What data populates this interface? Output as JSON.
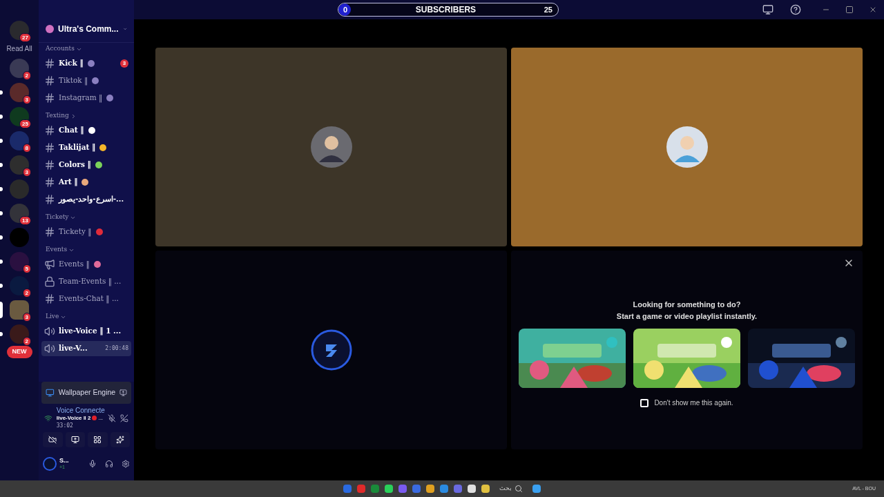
{
  "top_bar": {
    "counter": {
      "label": "SUBSCRIBERS",
      "start": "0",
      "end": "25",
      "level": 0.04
    }
  },
  "servers": {
    "read_all": "Read All",
    "items": [
      {
        "badge": "27",
        "color": "#2a2a2e",
        "unread": false,
        "selected": false
      },
      {
        "badge": "2",
        "color": "#3a3a55",
        "unread": false,
        "selected": false
      },
      {
        "badge": "3",
        "color": "#5a2a2a",
        "unread": true,
        "selected": false
      },
      {
        "badge": "25",
        "color": "#0f3a1f",
        "unread": true,
        "selected": false
      },
      {
        "badge": "8",
        "color": "#1a2a6a",
        "unread": true,
        "selected": false
      },
      {
        "badge": "3",
        "color": "#2e2e2e",
        "unread": true,
        "selected": false
      },
      {
        "color": "#2a2a2a",
        "unread": true,
        "selected": false
      },
      {
        "badge": "13",
        "color": "#33333a",
        "unread": true,
        "selected": false
      },
      {
        "color": "#000000",
        "unread": true,
        "selected": false
      },
      {
        "badge": "5",
        "color": "#2a1040",
        "unread": true,
        "selected": false
      },
      {
        "badge": "2",
        "color": "#0a1a40",
        "unread": true,
        "selected": false
      },
      {
        "badge": "3",
        "color": "#6a5a40",
        "unread": false,
        "selected": true
      },
      {
        "badge": "2",
        "color": "#3a1a1a",
        "unread": true,
        "selected": false
      }
    ],
    "new_badge": "NEW"
  },
  "server_header": {
    "name": "Ultra's Comm..."
  },
  "categories": [
    {
      "name": "Accounts",
      "expanded": true,
      "channels": [
        {
          "kind": "text",
          "name": "Kick ‖",
          "emoji": {
            "kind": "people"
          },
          "badge": "3",
          "unread": true,
          "selected": false
        },
        {
          "kind": "text",
          "name": "Tiktok ‖",
          "emoji": {
            "kind": "people"
          },
          "unread": false,
          "selected": false
        },
        {
          "kind": "text",
          "name": "Instagram ‖",
          "emoji": {
            "kind": "people"
          },
          "unread": false,
          "selected": false
        }
      ]
    },
    {
      "name": "Texting",
      "expanded": false,
      "channels": [
        {
          "kind": "text",
          "name": "Chat ‖",
          "emoji": {
            "kind": "speech"
          },
          "unread": true,
          "selected": false
        },
        {
          "kind": "text",
          "name": "Taklijat ‖",
          "emoji": {
            "kind": "laugh"
          },
          "unread": true,
          "selected": false
        },
        {
          "kind": "text",
          "name": "Colors ‖",
          "emoji": {
            "kind": "pencil"
          },
          "unread": true,
          "selected": false
        },
        {
          "kind": "text",
          "name": "Art ‖",
          "emoji": {
            "kind": "palette"
          },
          "unread": true,
          "selected": false
        },
        {
          "kind": "text",
          "name": "اسرع-واحد-يصور-...",
          "unread": true,
          "selected": false
        }
      ]
    },
    {
      "name": "Tickety",
      "expanded": true,
      "channels": [
        {
          "kind": "text",
          "name": "Tickety ‖",
          "emoji": {
            "kind": "ticket"
          },
          "unread": false,
          "selected": false
        }
      ]
    },
    {
      "name": "Events",
      "expanded": true,
      "channels": [
        {
          "kind": "announce",
          "name": "Events ‖",
          "emoji": {
            "kind": "tent"
          },
          "unread": false,
          "selected": false
        },
        {
          "kind": "locked",
          "name": "Team-Events ‖ ...",
          "unread": false,
          "selected": false
        },
        {
          "kind": "text",
          "name": "Events-Chat ‖ ...",
          "unread": false,
          "selected": false
        }
      ]
    },
    {
      "name": "Live",
      "expanded": true,
      "channels": [
        {
          "kind": "voice",
          "name": "live-Voice ‖ 1 ...",
          "unread": true,
          "selected": false
        },
        {
          "kind": "voice",
          "name": "live-V...",
          "time": "2:00:48",
          "unread": true,
          "selected": true
        }
      ]
    }
  ],
  "activity": {
    "name": "Wallpaper Engine"
  },
  "voice_panel": {
    "status": "Voice Connecte",
    "channel": "live-Voice ‖ 2",
    "suffix": "...",
    "elapsed": "33:02"
  },
  "user_panel": {
    "name": "S...",
    "extra": "+1"
  },
  "tiles": [
    {
      "kind": "avatar",
      "color": "#3d3528"
    },
    {
      "kind": "avatar",
      "color": "#9a6a2c"
    },
    {
      "kind": "logo",
      "color": "#05050e"
    }
  ],
  "activity_prompt": {
    "title": "Looking for something to do?",
    "subtitle": "Start a game or video playlist instantly.",
    "checkbox": {
      "label": "Don't show me this again.",
      "checked": false
    }
  },
  "taskbar": {
    "search": "بحث",
    "region": "AVL - BOU"
  }
}
